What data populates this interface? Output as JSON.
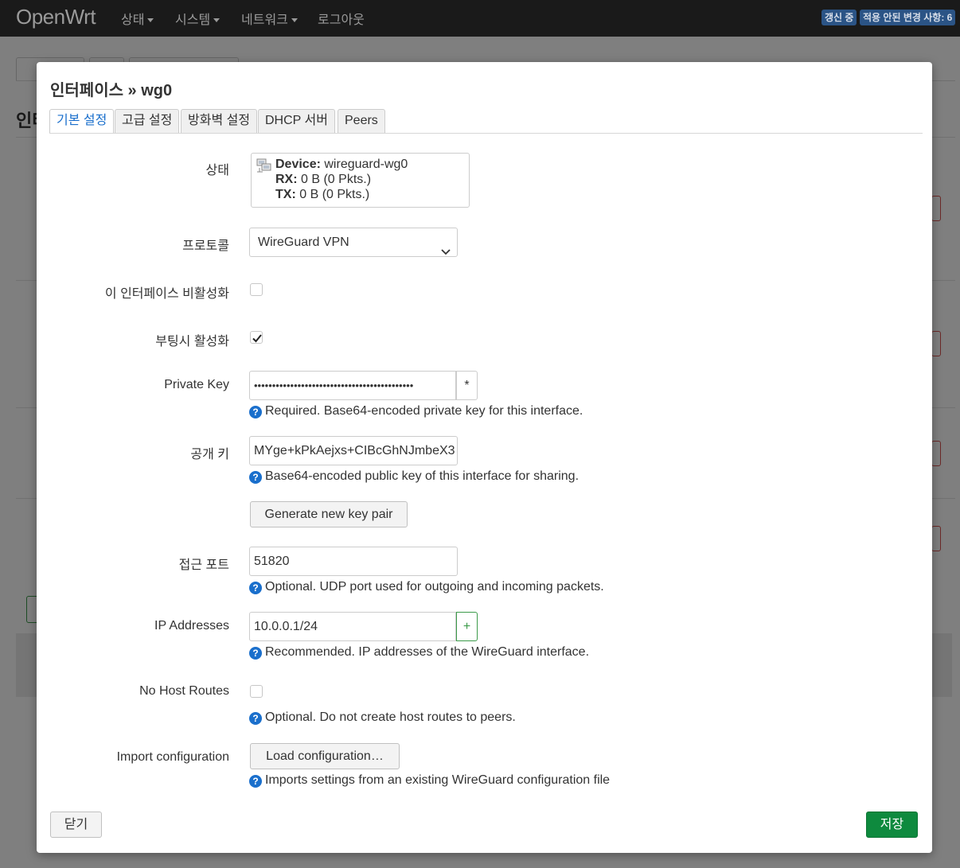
{
  "nav": {
    "brand": "OpenWrt",
    "menu": [
      "상태",
      "시스템",
      "네트워크"
    ],
    "logout": "로그아웃",
    "badge_updating": "갱신 중",
    "badge_changes": "적용 안된 변경 사항: 6"
  },
  "background": {
    "heading_fragment": "인터"
  },
  "modal": {
    "title": "인터페이스 » wg0",
    "tabs": [
      "기본 설정",
      "고급 설정",
      "방화벽 설정",
      "DHCP 서버",
      "Peers"
    ],
    "active_tab": "기본 설정",
    "status": {
      "label": "상태",
      "device_key": "Device:",
      "device_value": "wireguard-wg0",
      "rx_key": "RX:",
      "rx_value": "0 B (0 Pkts.)",
      "tx_key": "TX:",
      "tx_value": "0 B (0 Pkts.)"
    },
    "protocol": {
      "label": "프로토콜",
      "value": "WireGuard VPN"
    },
    "disable_iface": {
      "label": "이 인터페이스 비활성화",
      "checked": false
    },
    "boot_enable": {
      "label": "부팅시 활성화",
      "checked": true
    },
    "private_key": {
      "label": "Private Key",
      "masked": "••••••••••••••••••••••••••••••••••••••••••••",
      "reveal": "*",
      "help": "Required. Base64-encoded private key for this interface."
    },
    "public_key": {
      "label": "공개 키",
      "value": "MYge+kPkAejxs+CIBcGhNJmbeX3",
      "help": "Base64-encoded public key of this interface for sharing.",
      "generate_button": "Generate new key pair"
    },
    "listen_port": {
      "label": "접근 포트",
      "value": "51820",
      "help": "Optional. UDP port used for outgoing and incoming packets."
    },
    "ip_addresses": {
      "label": "IP Addresses",
      "value": "10.0.0.1/24",
      "add": "+",
      "help": "Recommended. IP addresses of the WireGuard interface."
    },
    "no_host_routes": {
      "label": "No Host Routes",
      "checked": false,
      "help": "Optional. Do not create host routes to peers."
    },
    "import_config": {
      "label": "Import configuration",
      "button": "Load configuration…",
      "help": "Imports settings from an existing WireGuard configuration file"
    },
    "close_button": "닫기",
    "save_button": "저장"
  },
  "colors": {
    "accent": "#1a6fcc",
    "save": "#0e8a3e",
    "nav_bg": "#1a1a1a",
    "badge_bg": "#2b5486"
  }
}
